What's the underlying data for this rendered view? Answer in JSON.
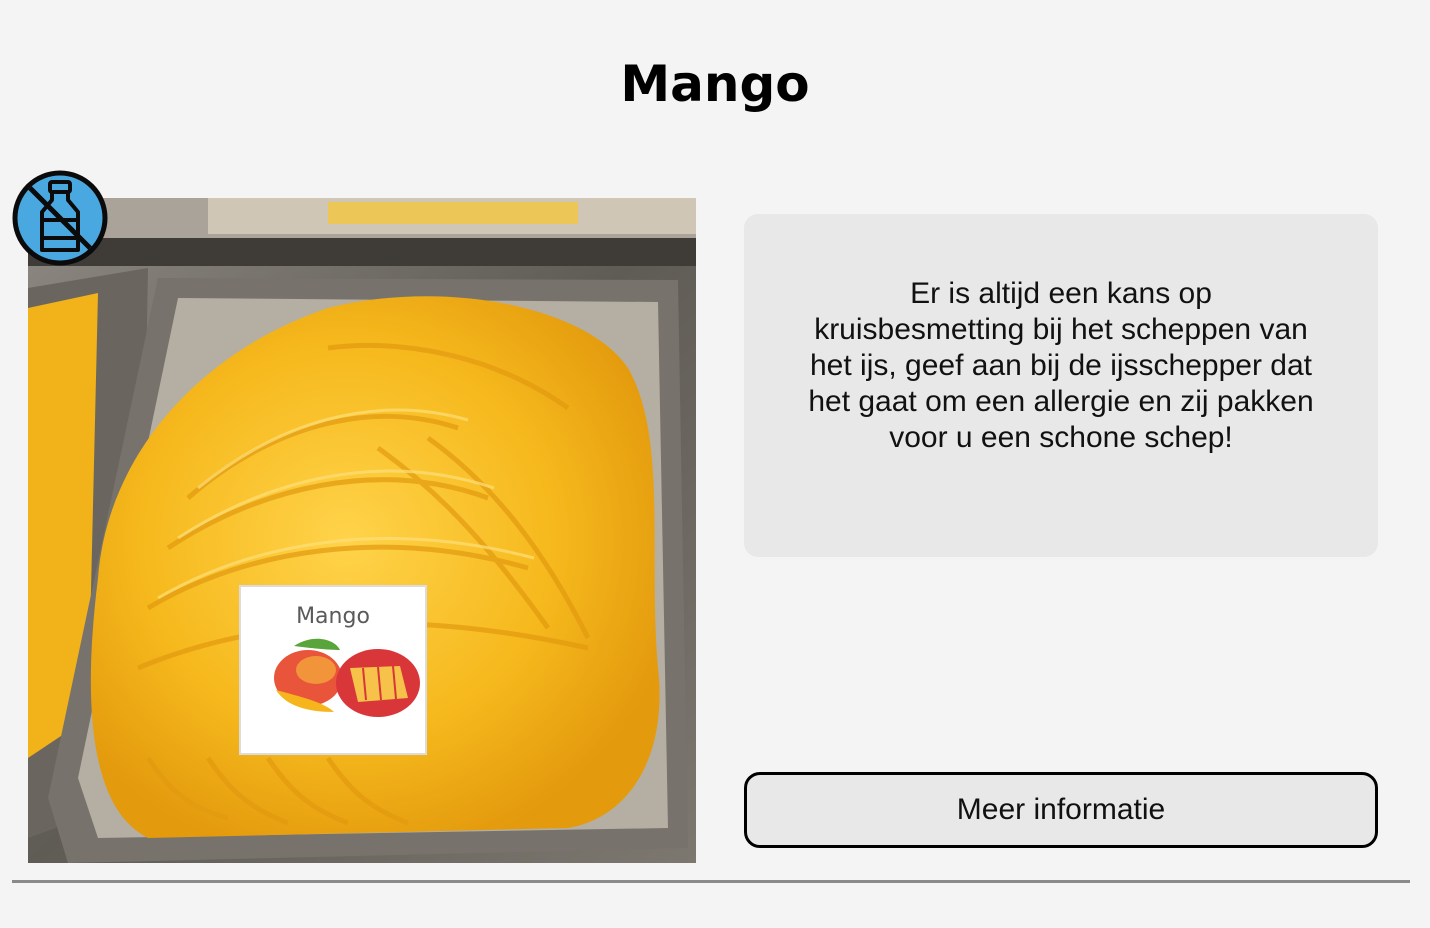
{
  "page": {
    "title": "Mango"
  },
  "product": {
    "image_label": "Mango",
    "allergen_icon": "no-milk-icon",
    "colors": {
      "sorbet": "#f5b81c",
      "badge_fill": "#4aa8e0",
      "panel_bg": "#e8e8e8",
      "page_bg": "#f4f4f4"
    }
  },
  "info": {
    "text": "Er is altijd een kans op kruisbesmetting bij het scheppen van het ijs, geef aan bij de ijsschepper dat het gaat om een allergie en zij pakken voor u een schone schep!"
  },
  "actions": {
    "more_info_label": "Meer informatie"
  }
}
